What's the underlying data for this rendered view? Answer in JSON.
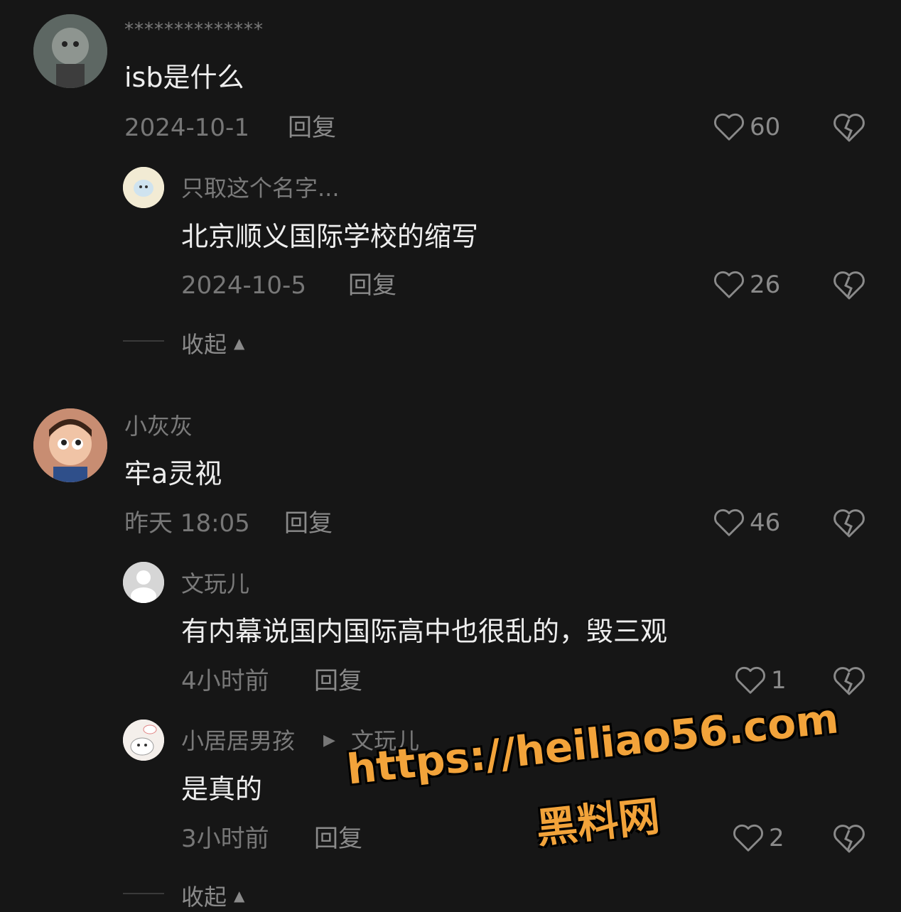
{
  "comments": [
    {
      "username": "**************",
      "text": "isb是什么",
      "date": "2024-10-1",
      "reply_label": "回复",
      "likes": "60",
      "replies": [
        {
          "username": "只取这个名字...",
          "text": "北京顺义国际学校的缩写",
          "date": "2024-10-5",
          "reply_label": "回复",
          "likes": "26"
        }
      ],
      "collapse_label": "收起"
    },
    {
      "username": "小灰灰",
      "text": "牢a灵视",
      "date": "昨天 18:05",
      "reply_label": "回复",
      "likes": "46",
      "replies": [
        {
          "username": "文玩儿",
          "text": "有内幕说国内国际高中也很乱的，毁三观",
          "date": "4小时前",
          "reply_label": "回复",
          "likes": "1"
        },
        {
          "username": "小居居男孩",
          "reply_to": "文玩儿",
          "text": "是真的",
          "date": "3小时前",
          "reply_label": "回复",
          "likes": "2"
        }
      ],
      "collapse_label": "收起"
    }
  ],
  "watermark": {
    "url": "https://heiliao56.com",
    "name": "黑料网"
  },
  "colors": {
    "background": "#161616",
    "text": "#eeeeee",
    "muted": "#777777",
    "watermark": "#f2a33a"
  },
  "icons": [
    "heart-icon",
    "broken-heart-icon",
    "chevron-up-icon",
    "play-triangle-icon"
  ]
}
